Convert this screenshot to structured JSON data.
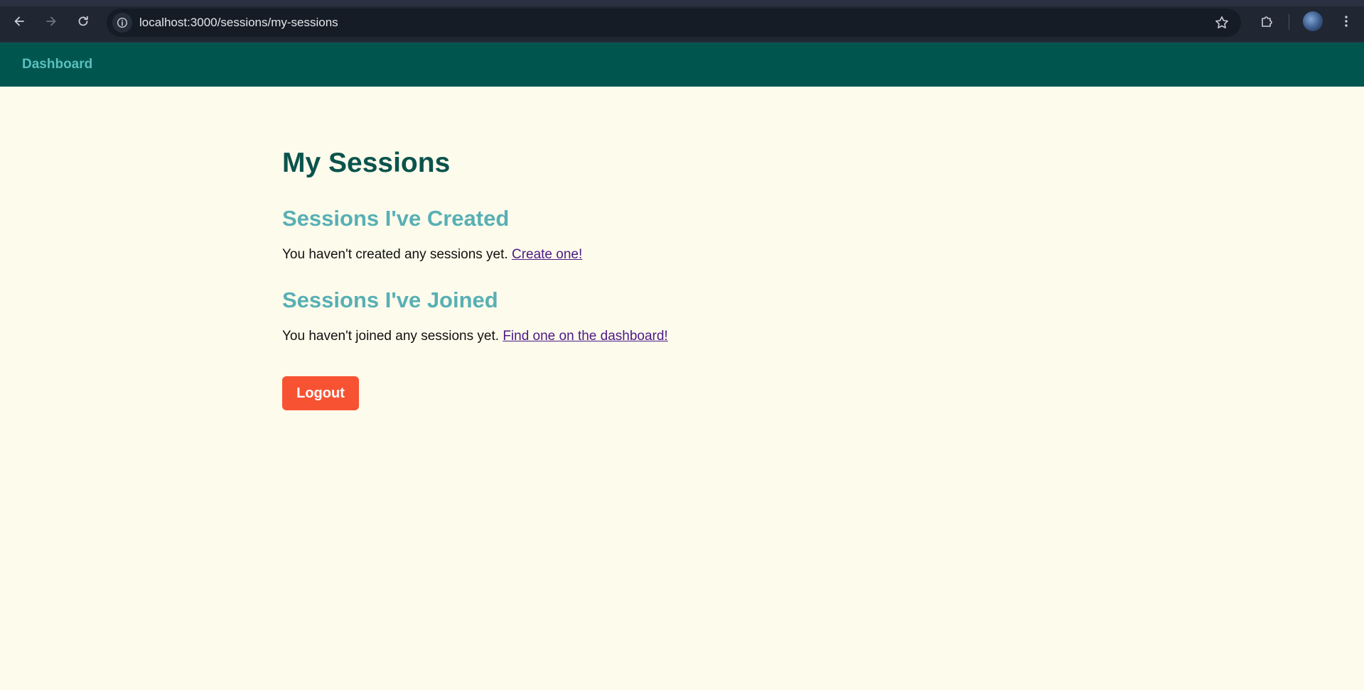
{
  "browser": {
    "url": "localhost:3000/sessions/my-sessions"
  },
  "header": {
    "brand_label": "Dashboard",
    "bg_color": "#00564f"
  },
  "page": {
    "title": "My Sessions",
    "created": {
      "heading": "Sessions I've Created",
      "empty_text": "You haven't created any sessions yet.",
      "link_label": "Create one!"
    },
    "joined": {
      "heading": "Sessions I've Joined",
      "empty_text": "You haven't joined any sessions yet.",
      "link_label": "Find one on the dashboard!"
    },
    "logout_label": "Logout"
  },
  "colors": {
    "page_bg": "#fdfbec",
    "accent": "#58b0b4",
    "title": "#0b534d",
    "logout_button": "#f75333"
  }
}
